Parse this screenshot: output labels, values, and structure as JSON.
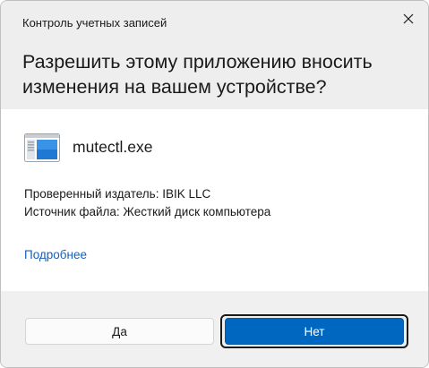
{
  "window": {
    "title": "Контроль учетных записей"
  },
  "header": {
    "question": "Разрешить этому приложению вносить изменения на вашем устройстве?"
  },
  "app": {
    "name": "mutectl.exe",
    "icon": "application-window-icon",
    "publisher_line": "Проверенный издатель: IBIK LLC",
    "source_line": "Источник файла: Жесткий диск компьютера"
  },
  "details": {
    "label": "Подробнее"
  },
  "buttons": {
    "yes_label": "Да",
    "no_label": "Нет"
  },
  "colors": {
    "header_bg": "#eeeeee",
    "footer_bg": "#f0f0f0",
    "accent": "#0067c0",
    "link": "#1a5fb4"
  }
}
